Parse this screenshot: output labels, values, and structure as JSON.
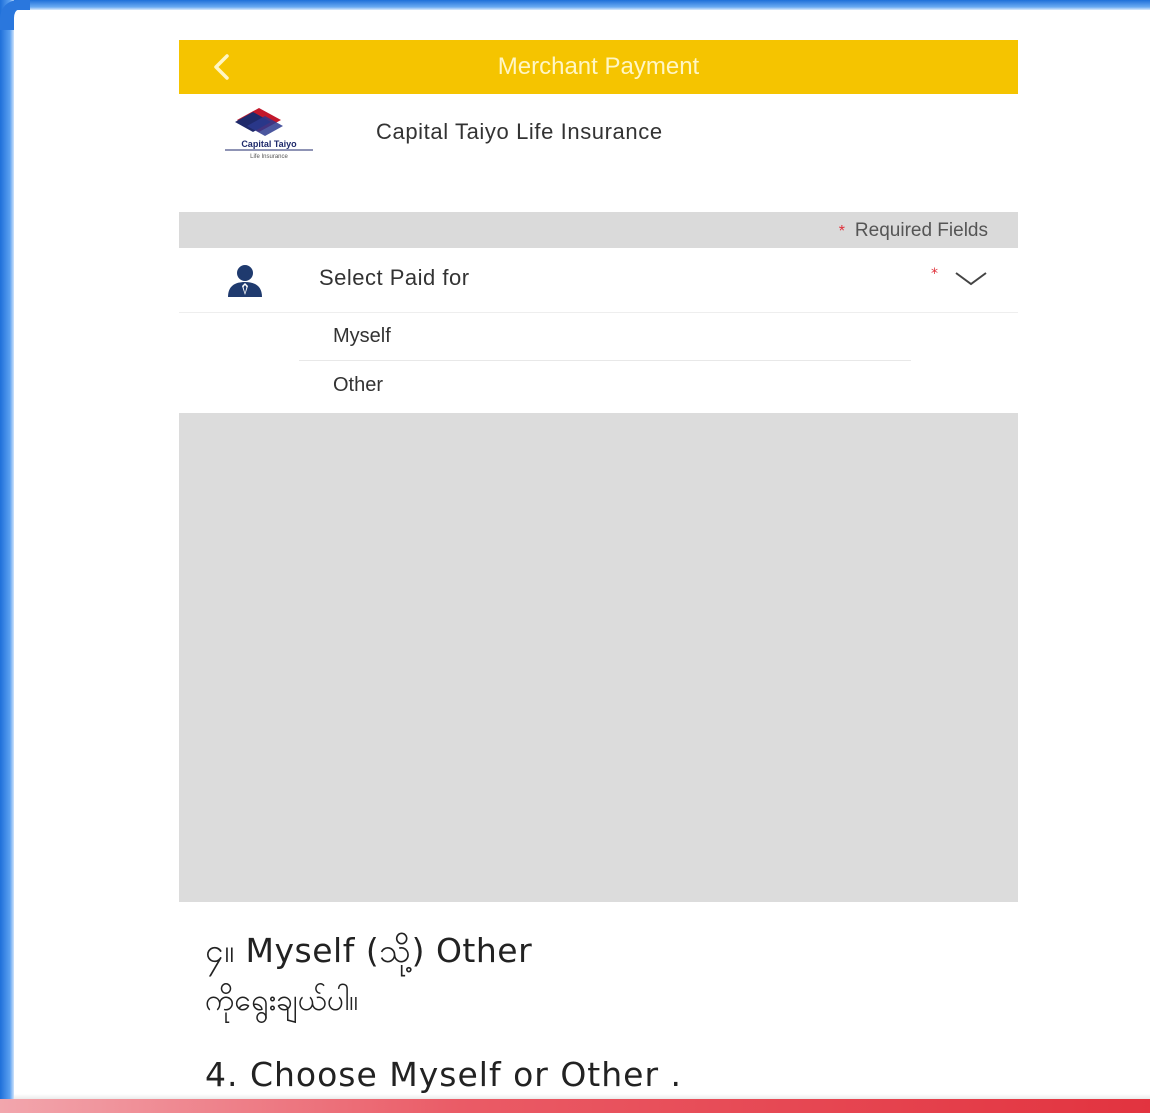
{
  "header": {
    "title": "Merchant Payment",
    "back_icon": "chevron-left-icon"
  },
  "merchant": {
    "name": "Capital Taiyo Life Insurance",
    "logo_text_line1": "Capital Taiyo",
    "logo_text_line2": "Life Insurance"
  },
  "form": {
    "required_note": "Required Fields",
    "required_marker": "*",
    "select_label": "Select Paid for",
    "select_icon": "person-icon",
    "dropdown_icon": "chevron-down-icon",
    "options": [
      {
        "label": "Myself"
      },
      {
        "label": "Other"
      }
    ]
  },
  "instructions": {
    "myanmar_line1": "၄။ Myself (သို့) Other",
    "myanmar_line2": "ကိုရွေးချယ်ပါ။",
    "english": "4. Choose Myself or Other ."
  },
  "colors": {
    "header": "#f5c400",
    "required": "#e0303a",
    "frame_blue": "#1e6fd9",
    "frame_red": "#e2333f"
  }
}
